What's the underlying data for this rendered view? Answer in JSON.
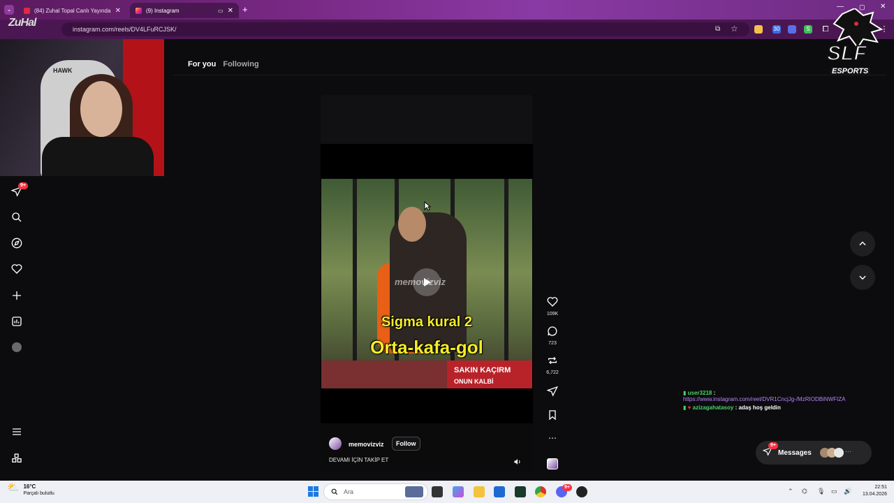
{
  "browser": {
    "tabs": [
      {
        "title": "(84) Zuhal Topal Canlı Yayında",
        "favicon_color": "#e02a3a"
      },
      {
        "title": "(9) Instagram",
        "favicon_color": "#d63384"
      }
    ],
    "url": "instagram.com/reels/DV4LFuRCJSK/"
  },
  "overlay": {
    "streamer_logo": "ZuHal",
    "webcam_logo": "HAWK",
    "brand_logo": {
      "line1": "SLF",
      "line2": "ESPORTS"
    }
  },
  "instagram": {
    "nav": {
      "for_you": "For you",
      "following": "Following"
    },
    "sidebar": {
      "notification_badge": "9+"
    },
    "reel": {
      "username": "memovizviz",
      "follow_label": "Follow",
      "caption": "DEVAMI İÇİN TAKİP ET",
      "video_watermark": "memovizviz",
      "video_caption_line1": "Sigma kural 2",
      "video_caption_line2": "Orta-kafa-gol",
      "video_banner_line1": "SAKIN KAÇIRM",
      "video_banner_line2": "ONUN KALBİ"
    },
    "actions": {
      "likes": "109K",
      "comments": "723",
      "reposts": "6,722"
    },
    "messages": {
      "label": "Messages",
      "badge": "9+"
    }
  },
  "chat": [
    {
      "user": "user3218",
      "text": "https://www.instagram.com/reel/DVR1CncjJg-/MzRIODBiNWFIZA",
      "is_link": true
    },
    {
      "user": "azizagahatasoy",
      "text": ": adaş hoş geldin",
      "is_link": false
    }
  ],
  "taskbar": {
    "weather_temp": "16°C",
    "weather_desc": "Parçalı bulutlu",
    "search_placeholder": "Ara",
    "time": "22:51",
    "date": "13.04.2026",
    "discord_badge": "9+"
  },
  "colors": {
    "browser_accent": "#7a2a86",
    "like_red": "#ff3040",
    "chat_name_green": "#4ad36a",
    "chat_link_purple": "#b983ff",
    "caption_yellow": "#f4ec2a"
  }
}
